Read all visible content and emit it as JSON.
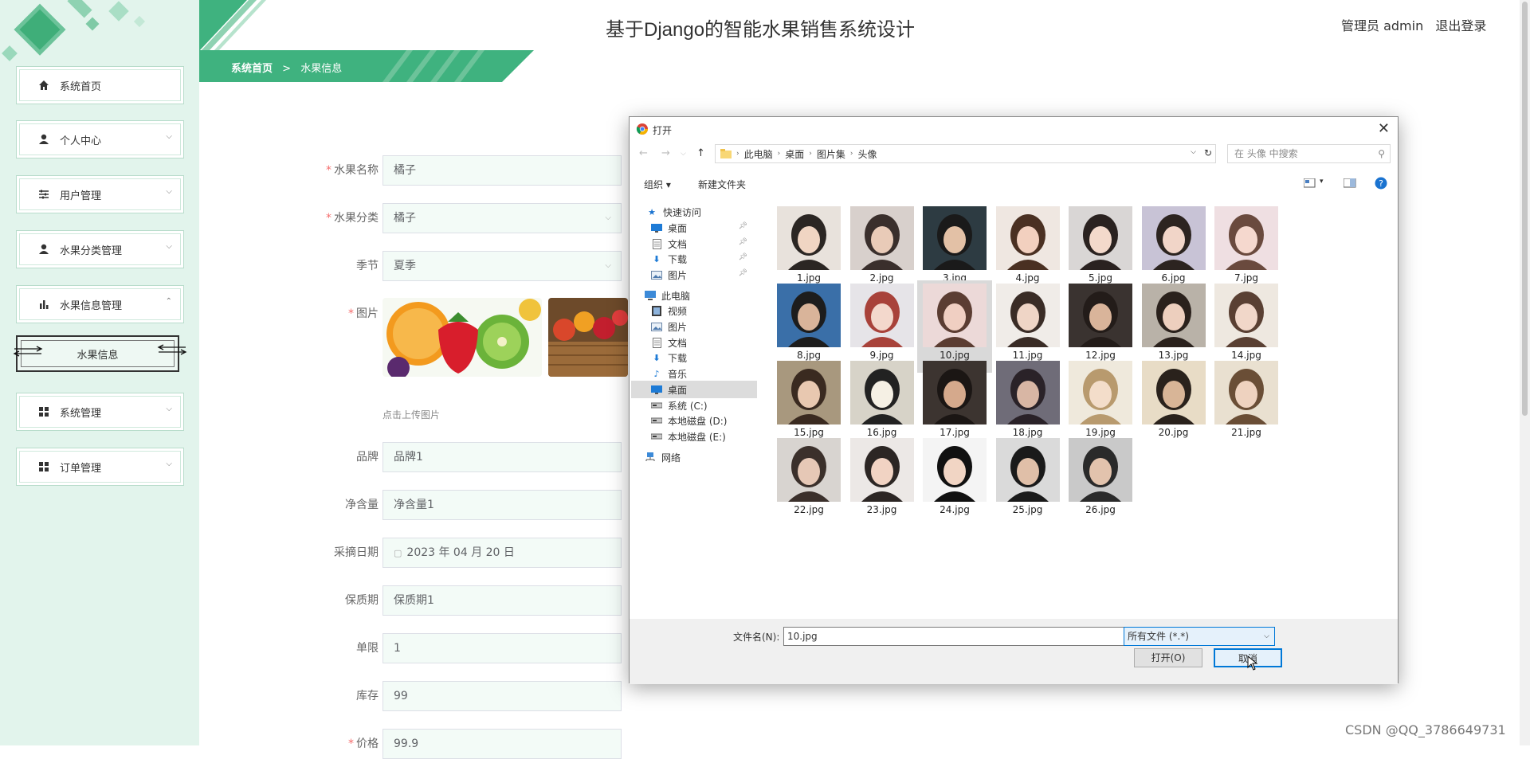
{
  "header": {
    "title": "基于Django的智能水果销售系统设计",
    "user_label": "管理员 admin",
    "logout_label": "退出登录"
  },
  "breadcrumb": {
    "home": "系统首页",
    "sep": ">",
    "current": "水果信息"
  },
  "sidebar": {
    "items": [
      {
        "label": "系统首页",
        "icon": "home-icon",
        "arrow": ""
      },
      {
        "label": "个人中心",
        "icon": "user-icon",
        "arrow": "⌵"
      },
      {
        "label": "用户管理",
        "icon": "sliders-icon",
        "arrow": "⌵"
      },
      {
        "label": "水果分类管理",
        "icon": "user-icon",
        "arrow": "⌵"
      },
      {
        "label": "水果信息管理",
        "icon": "bar-chart-icon",
        "arrow": "⌃"
      },
      {
        "label": "系统管理",
        "icon": "grid-icon",
        "arrow": "⌵"
      },
      {
        "label": "订单管理",
        "icon": "grid-icon",
        "arrow": "⌵"
      }
    ],
    "sub_item": "水果信息"
  },
  "form": {
    "fields": [
      {
        "label": "水果名称",
        "value": "橘子",
        "required": "*"
      },
      {
        "label": "水果分类",
        "value": "橘子",
        "required": "*"
      },
      {
        "label": "季节",
        "value": "夏季",
        "required": ""
      },
      {
        "label": "图片",
        "value": "",
        "required": "*"
      },
      {
        "label": "品牌",
        "value": "品牌1",
        "required": ""
      },
      {
        "label": "净含量",
        "value": "净含量1",
        "required": ""
      },
      {
        "label": "采摘日期",
        "value": "2023 年 04 月 20 日",
        "required": ""
      },
      {
        "label": "保质期",
        "value": "保质期1",
        "required": ""
      },
      {
        "label": "单限",
        "value": "1",
        "required": ""
      },
      {
        "label": "库存",
        "value": "99",
        "required": ""
      },
      {
        "label": "价格",
        "value": "99.9",
        "required": "*"
      }
    ],
    "upload_tip": "点击上传图片"
  },
  "dialog": {
    "title": "打开",
    "address": [
      "此电脑",
      "桌面",
      "图片集",
      "头像"
    ],
    "search_placeholder": "在 头像 中搜索",
    "organize": "组织 ▾",
    "new_folder": "新建文件夹",
    "nav_tree": [
      {
        "label": "快速访问",
        "icon": "star-icon"
      },
      {
        "label": "桌面",
        "icon": "desktop-icon"
      },
      {
        "label": "文档",
        "icon": "document-icon"
      },
      {
        "label": "下载",
        "icon": "download-icon"
      },
      {
        "label": "图片",
        "icon": "pictures-icon"
      },
      {
        "label": "此电脑",
        "icon": "computer-icon"
      },
      {
        "label": "视频",
        "icon": "video-icon"
      },
      {
        "label": "图片",
        "icon": "pictures-icon"
      },
      {
        "label": "文档",
        "icon": "document-icon"
      },
      {
        "label": "下载",
        "icon": "download-icon"
      },
      {
        "label": "音乐",
        "icon": "music-icon"
      },
      {
        "label": "桌面",
        "icon": "desktop-icon"
      },
      {
        "label": "系统 (C:)",
        "icon": "drive-icon"
      },
      {
        "label": "本地磁盘 (D:)",
        "icon": "drive-icon"
      },
      {
        "label": "本地磁盘 (E:)",
        "icon": "drive-icon"
      },
      {
        "label": "网络",
        "icon": "network-icon"
      }
    ],
    "files": [
      "1.jpg",
      "2.jpg",
      "3.jpg",
      "4.jpg",
      "5.jpg",
      "6.jpg",
      "7.jpg",
      "8.jpg",
      "9.jpg",
      "10.jpg",
      "11.jpg",
      "12.jpg",
      "13.jpg",
      "14.jpg",
      "15.jpg",
      "16.jpg",
      "17.jpg",
      "18.jpg",
      "19.jpg",
      "20.jpg",
      "21.jpg",
      "22.jpg",
      "23.jpg",
      "24.jpg",
      "25.jpg",
      "26.jpg"
    ],
    "selected_file": "10.jpg",
    "filename_label": "文件名(N):",
    "filename_value": "10.jpg",
    "filetype": "所有文件 (*.*)",
    "open_button": "打开(O)",
    "cancel_button": "取消"
  },
  "watermark": "CSDN @QQ_3786649731",
  "colors": {
    "accent": "#3fb27f",
    "sidebar_bg": "#e2f4ec",
    "selection": "#0078d7"
  }
}
